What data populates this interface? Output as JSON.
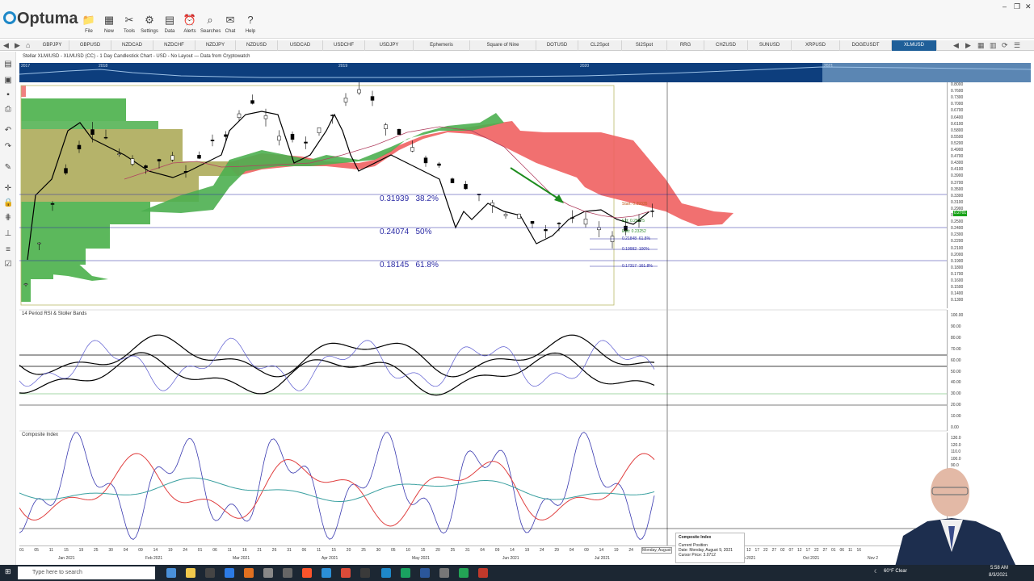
{
  "app": {
    "name": "Optuma",
    "window_controls": [
      "–",
      "❐",
      "✕"
    ]
  },
  "toolbar": [
    {
      "label": "File",
      "icon": "folder-icon",
      "glyph": "📁"
    },
    {
      "label": "New",
      "icon": "new-chart-icon",
      "glyph": "▦"
    },
    {
      "label": "Tools",
      "icon": "tools-icon",
      "glyph": "✂"
    },
    {
      "label": "Settings",
      "icon": "gear-icon",
      "glyph": "⚙"
    },
    {
      "label": "Data",
      "icon": "data-icon",
      "glyph": "▤"
    },
    {
      "label": "Alerts",
      "icon": "alarm-icon",
      "glyph": "⏰"
    },
    {
      "label": "Searches",
      "icon": "search-icon",
      "glyph": "⌕"
    },
    {
      "label": "Chat",
      "icon": "chat-icon",
      "glyph": "✉"
    },
    {
      "label": "Help",
      "icon": "help-icon",
      "glyph": "?"
    }
  ],
  "tabs": [
    "GBPJPY",
    "GBPUSD",
    "NZDCAD",
    "NZDCHF",
    "NZDJPY",
    "NZDUSD",
    "USDCAD",
    "USDCHF",
    "USDJPY",
    "Ephemeris",
    "Square of Nine",
    "DOTUSD",
    "CL2Spot",
    "SI2Spot",
    "RRG",
    "CHZUSD",
    "SUNUSD",
    "XRPUSD",
    "DOGEUSDT",
    "XLMUSD"
  ],
  "active_tab": "XLMUSD",
  "chart_info": "Stellar XLM/USD - XLMUSD (CC) - 1 Day Candlestick Chart - USD - No Layout — Data from Cryptowatch",
  "overview_years": [
    "2017",
    "2018",
    "2019",
    "2020",
    "2021"
  ],
  "price_chart": {
    "axis": [
      "0.8000",
      "0.7600",
      "0.7300",
      "0.7000",
      "0.6700",
      "0.6400",
      "0.6100",
      "0.5800",
      "0.5500",
      "0.5200",
      "0.4900",
      "0.4700",
      "0.4300",
      "0.4100",
      "0.3900",
      "0.3700",
      "0.3500",
      "0.3300",
      "0.3100",
      "0.2900",
      "0.2700",
      "0.2500",
      "0.2400",
      "0.2300",
      "0.2200",
      "0.2100",
      "0.2000",
      "0.1900",
      "0.1800",
      "0.1700",
      "0.1600",
      "0.1500",
      "0.1400",
      "0.1300"
    ],
    "current_price": "0.2701",
    "fib_levels": [
      {
        "price": "0.31939",
        "pct": "38.2%"
      },
      {
        "price": "0.24074",
        "pct": "50%"
      },
      {
        "price": "0.18145",
        "pct": "61.8%"
      }
    ],
    "fib_small": [
      {
        "text": "Start: 0.29335"
      },
      {
        "text": "Ext: 0.25175"
      },
      {
        "text": "End: 0.23252"
      },
      {
        "price": "0.21848",
        "pct": "61.8%"
      },
      {
        "price": "0.19992",
        "pct": "100%"
      },
      {
        "price": "0.17317",
        "pct": "161.8%"
      }
    ]
  },
  "rsi_panel": {
    "title": "14 Period RSI & Stoller Bands",
    "axis": [
      "100.00",
      "90.00",
      "80.00",
      "70.00",
      "60.00",
      "50.00",
      "40.00",
      "30.00",
      "20.00",
      "10.00",
      "0.00"
    ]
  },
  "composite_panel": {
    "title": "Composite Index",
    "axis": [
      "130.0",
      "120.0",
      "110.0",
      "100.0",
      "90.0"
    ]
  },
  "date_axis": {
    "days": [
      "01",
      "05",
      "11",
      "15",
      "19",
      "25",
      "30",
      "04",
      "09",
      "14",
      "19",
      "24",
      "01",
      "06",
      "11",
      "16",
      "21",
      "26",
      "31",
      "06",
      "11",
      "15",
      "20",
      "25",
      "30",
      "05",
      "10",
      "15",
      "20",
      "25",
      "31",
      "04",
      "09",
      "14",
      "19",
      "24",
      "29",
      "04",
      "09",
      "14",
      "19",
      "24"
    ],
    "months": [
      "Jan 2021",
      "Feb 2021",
      "Mar 2021",
      "Apr 2021",
      "May 2021",
      "Jun 2021",
      "Jul 2021"
    ],
    "cursor_date": "Monday, August",
    "right_days": [
      "12",
      "17",
      "22",
      "27",
      "02",
      "07",
      "12",
      "17",
      "22",
      "27",
      "01",
      "06",
      "11",
      "16"
    ],
    "right_months": [
      "p 2021",
      "Oct 2021",
      "Nov 2"
    ]
  },
  "tooltip": {
    "title": "Composite Index",
    "line1": "Current Position",
    "line2": "Date: Monday, August 9, 2021",
    "line3": "Cursor Price: 3.0712"
  },
  "taskbar": {
    "search_placeholder": "Type here to search",
    "weather": "60°F Clear",
    "time": "5:58 AM",
    "date": "8/3/2021"
  },
  "colors": {
    "ichimoku_red": "#f06060",
    "ichimoku_green": "#4caf50",
    "fib_blue": "#2b2ba5",
    "tab_active": "#1f5f99"
  }
}
